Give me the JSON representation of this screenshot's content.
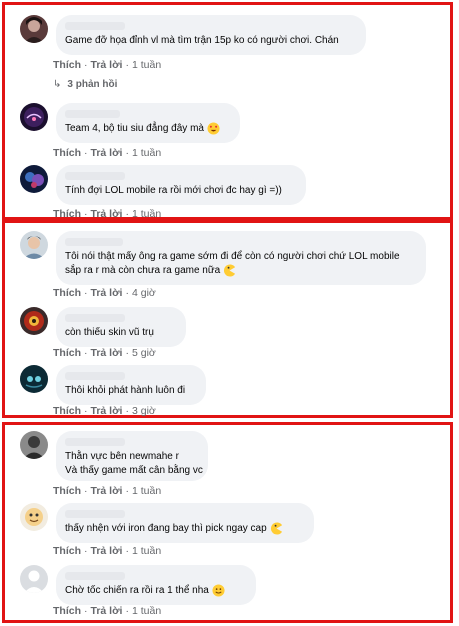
{
  "labels": {
    "like": "Thích",
    "reply": "Trả lời",
    "sep": "·"
  },
  "panels": [
    {
      "comments": [
        {
          "text": "Game đỡ họa đỉnh vl mà tìm trận 15p ko có người chơi. Chán",
          "time": "1 tuần",
          "replies": "3 phản hồi"
        },
        {
          "text": "Team 4, bộ tiu siu đẳng đây mà",
          "time": "1 tuần",
          "emoji": "heart-eyes-emoji"
        },
        {
          "text": "Tính đợi LOL mobile ra rồi mới chơi đc hay gì =))",
          "time": "1 tuần"
        }
      ]
    },
    {
      "comments": [
        {
          "text1": "Tôi nói thật mấy ông ra game sớm đi để còn có người chơi chứ LOL mobile",
          "text2": "sắp ra r mà còn chưa ra game nữa",
          "time": "4 giờ",
          "emoji": "pacman-emoji"
        },
        {
          "text": "còn thiếu skin vũ trụ",
          "time": "5 giờ"
        },
        {
          "text": "Thôi khỏi phát hành luôn đi",
          "time": "3 giờ"
        }
      ]
    },
    {
      "comments": [
        {
          "text1": "Thằn vực bên newmahe r",
          "text2": "Và thấy game mất cân bằng vc",
          "time": "1 tuần"
        },
        {
          "text": "thấy nhện với iron đang bay thì pick ngay cap",
          "time": "1 tuần",
          "emoji": "pacman-emoji"
        },
        {
          "text": "Chờ tốc chiến ra rồi ra 1 thể nha",
          "time": "1 tuần",
          "emoji": "smile-emoji"
        }
      ]
    }
  ],
  "colors": {
    "frame": "#e11414",
    "bubble": "#f0f2f5",
    "meta": "#65676b"
  }
}
